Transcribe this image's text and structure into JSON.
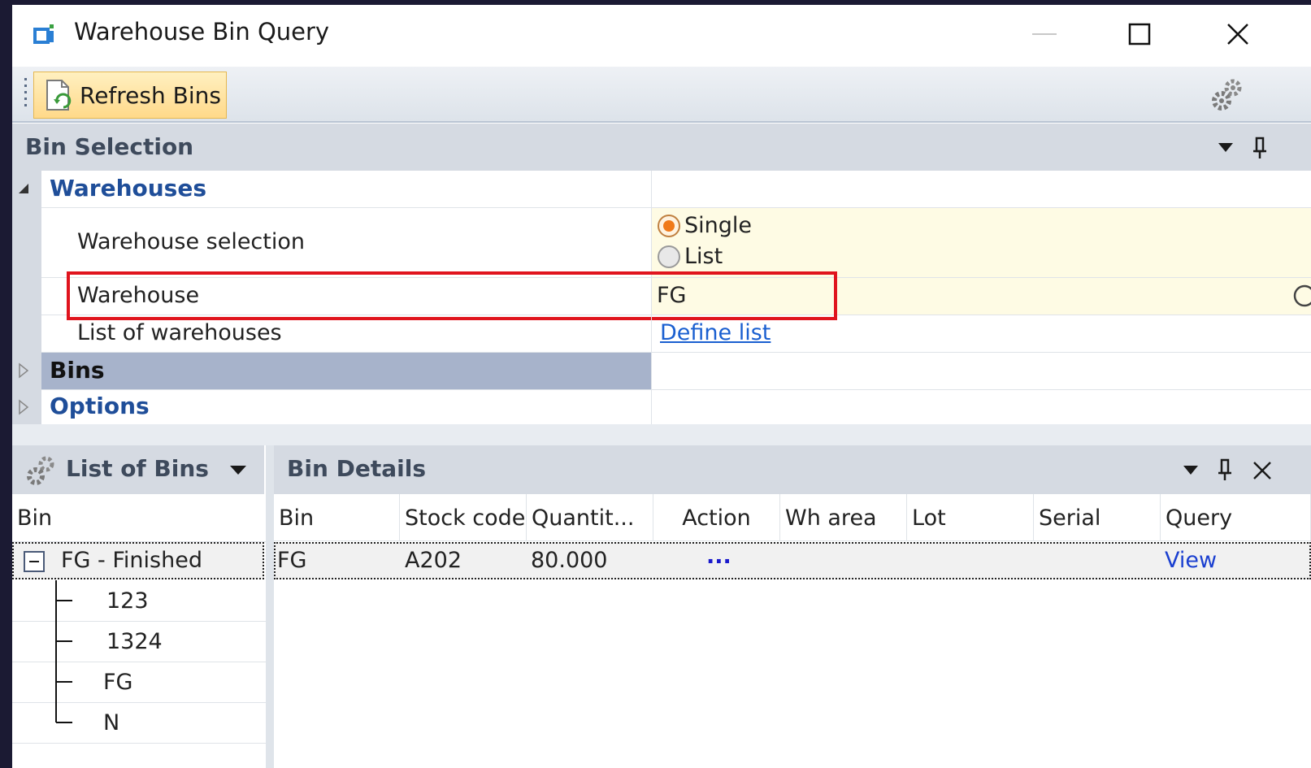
{
  "window": {
    "title": "Warehouse Bin Query"
  },
  "toolbar": {
    "refresh_label": "Refresh Bins"
  },
  "bin_selection": {
    "title": "Bin Selection",
    "categories": {
      "warehouses": "Warehouses",
      "bins": "Bins",
      "options": "Options"
    },
    "warehouse_selection_label": "Warehouse selection",
    "radio_single": "Single",
    "radio_list": "List",
    "selected_mode": "Single",
    "warehouse_label": "Warehouse",
    "warehouse_value": "FG",
    "list_of_warehouses_label": "List of warehouses",
    "define_list_link": "Define list"
  },
  "list_of_bins": {
    "title": "List of Bins",
    "column": "Bin",
    "root": "FG - Finished",
    "children": [
      "123",
      "1324",
      "FG",
      "N"
    ]
  },
  "bin_details": {
    "title": "Bin Details",
    "columns": [
      "Bin",
      "Stock code",
      "Quantit...",
      "Action",
      "Wh area",
      "Lot",
      "Serial",
      "Query"
    ],
    "rows": [
      {
        "bin": "FG",
        "stock_code": "A202",
        "quantity": "80.000",
        "action": "...",
        "wh_area": "",
        "lot": "",
        "serial": "",
        "query": "View"
      }
    ]
  },
  "colors": {
    "highlight_border": "#e0141e",
    "category_text": "#1f4e99",
    "link": "#1a5fd0",
    "editable_bg": "#fefbe4",
    "selected_category_bg": "#a7b3cb"
  }
}
